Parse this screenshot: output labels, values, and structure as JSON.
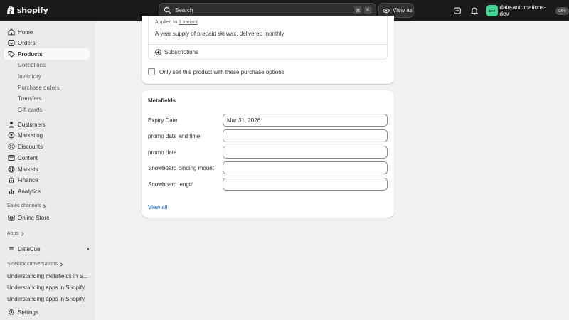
{
  "topbar": {
    "logo_text": "shopify",
    "search_placeholder": "Search",
    "search_shortcut": [
      "⌘",
      "K"
    ],
    "view_as_label": "View as",
    "avatar_initials": "DAT",
    "store_name": "date-automations-dev",
    "env_badge": "dev"
  },
  "sidebar": {
    "nav": [
      {
        "label": "Home",
        "icon": "home-icon"
      },
      {
        "label": "Orders",
        "icon": "orders-icon"
      },
      {
        "label": "Products",
        "icon": "tag-icon",
        "active": true
      }
    ],
    "product_sub": [
      "Collections",
      "Inventory",
      "Purchase orders",
      "Transfers",
      "Gift cards"
    ],
    "nav2": [
      {
        "label": "Customers",
        "icon": "person-icon"
      },
      {
        "label": "Marketing",
        "icon": "target-icon"
      },
      {
        "label": "Discounts",
        "icon": "discount-icon"
      },
      {
        "label": "Content",
        "icon": "content-icon"
      },
      {
        "label": "Markets",
        "icon": "globe-icon"
      },
      {
        "label": "Finance",
        "icon": "bank-icon"
      },
      {
        "label": "Analytics",
        "icon": "chart-icon"
      }
    ],
    "sales_channels_header": "Sales channels",
    "online_store": "Online Store",
    "apps_header": "Apps",
    "app_datecue": "DateCue",
    "sidekick_header": "Sidekick conversations",
    "sidekick_items": [
      "Understanding metafields in S...",
      "Understanding apps in Shopify",
      "Understanding apps in Shopify"
    ],
    "settings": "Settings"
  },
  "purchase_options": {
    "applied_prefix": "Applied to",
    "applied_link": "1 variant",
    "plan_description": "A year supply of prepaid ski wax, delivered monthly",
    "subscriptions_label": "Subscriptions",
    "only_sell_label": "Only sell this product with these purchase options",
    "only_sell_checked": false
  },
  "metafields": {
    "title": "Metafields",
    "fields": [
      {
        "label": "Expiry Date",
        "value": "Mar 31, 2026"
      },
      {
        "label": "promo date and time",
        "value": ""
      },
      {
        "label": "promo date",
        "value": ""
      },
      {
        "label": "Snowboard binding mount",
        "value": ""
      },
      {
        "label": "Snowboard length",
        "value": ""
      }
    ],
    "view_all": "View all"
  },
  "colors": {
    "topbar_bg": "#1a1a1a",
    "sidebar_bg": "#ebebeb",
    "page_bg": "#f1f1f1",
    "link": "#005bd3",
    "avatar_bg": "#43d693"
  }
}
